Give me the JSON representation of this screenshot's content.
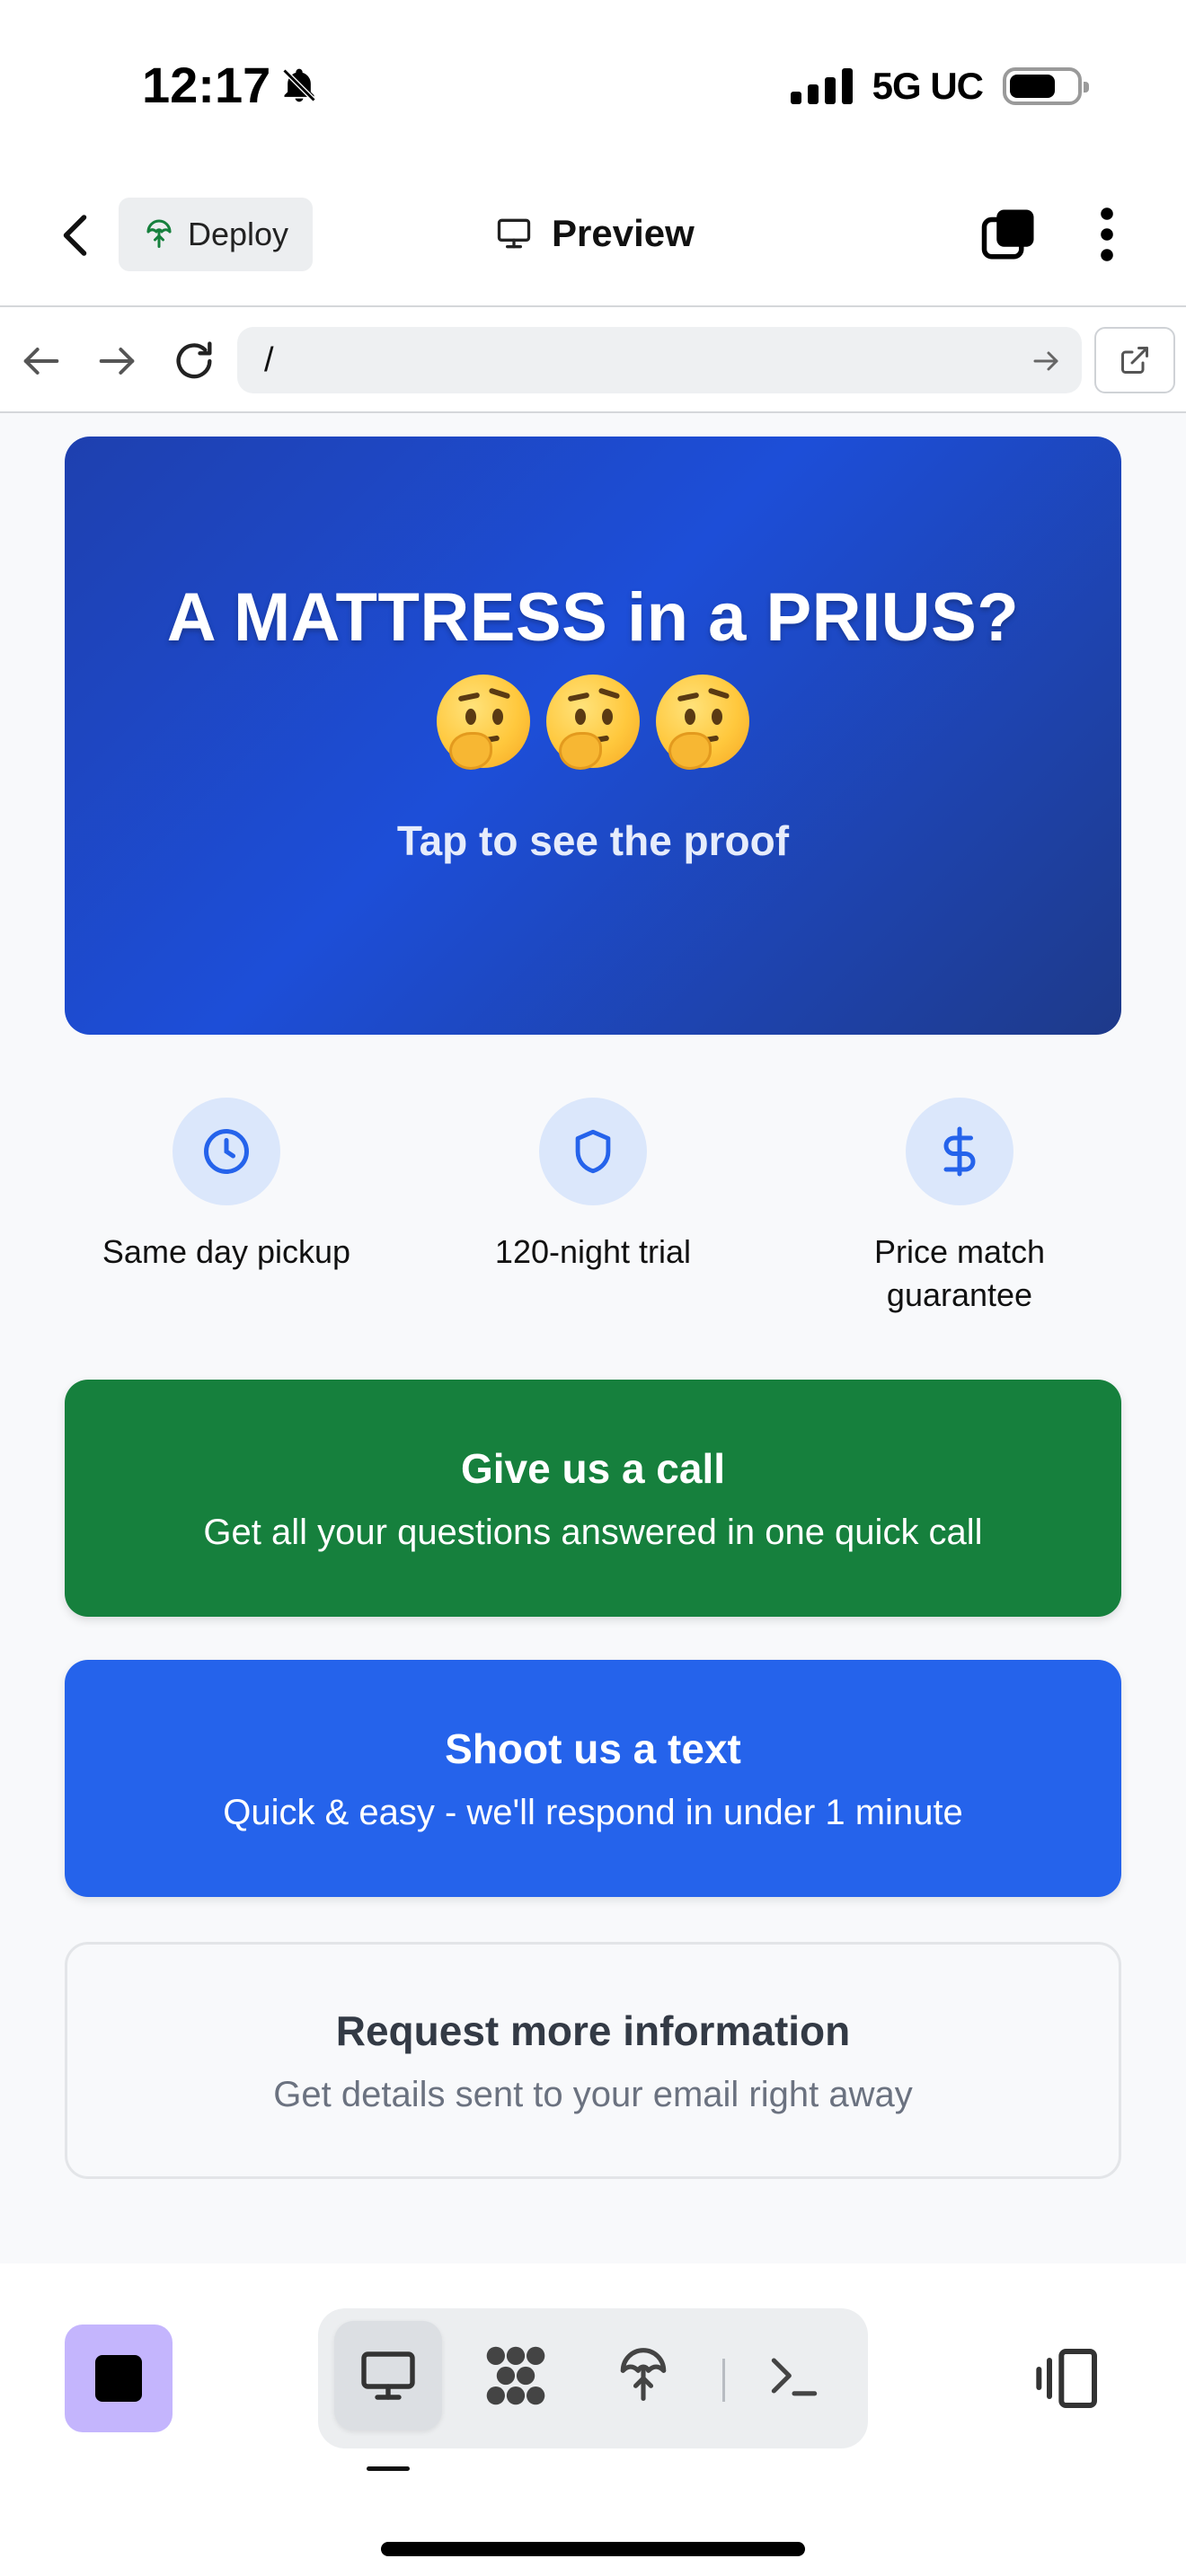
{
  "status_bar": {
    "time": "12:17",
    "network": "5G UC",
    "icons": [
      "bell-slash-icon",
      "signal-icon",
      "battery-icon"
    ]
  },
  "header": {
    "deploy_label": "Deploy",
    "title": "Preview",
    "icons": [
      "back-chevron-icon",
      "deploy-icon",
      "monitor-icon",
      "tabs-icon",
      "more-vertical-icon"
    ]
  },
  "url_bar": {
    "url": "/",
    "icons": [
      "arrow-left-icon",
      "arrow-right-icon",
      "reload-icon",
      "go-arrow-icon",
      "external-link-icon"
    ]
  },
  "hero": {
    "title": "A MATTRESS in a PRIUS?",
    "emoji_count": 3,
    "emoji": "thinking-face",
    "subtitle": "Tap to see the proof",
    "gradient": [
      "#1e40af",
      "#1d4ed8",
      "#1e3a8a"
    ]
  },
  "features": [
    {
      "icon": "clock-icon",
      "label": "Same day pickup"
    },
    {
      "icon": "shield-icon",
      "label": "120-night trial"
    },
    {
      "icon": "dollar-icon",
      "label": "Price match guarantee"
    }
  ],
  "cta": {
    "call": {
      "title": "Give us a call",
      "subtitle": "Get all your questions answered in one quick call",
      "color": "#16803d"
    },
    "text": {
      "title": "Shoot us a text",
      "subtitle": "Quick & easy - we'll respond in under 1 minute",
      "color": "#2563eb"
    },
    "info": {
      "title": "Request more information",
      "subtitle": "Get details sent to your email right away"
    }
  },
  "bottom_bar": {
    "tools": [
      "monitor-icon",
      "apps-icon",
      "deploy-icon",
      "terminal-icon"
    ],
    "active_tool": "monitor-icon",
    "accent": "#c4b5fd"
  }
}
